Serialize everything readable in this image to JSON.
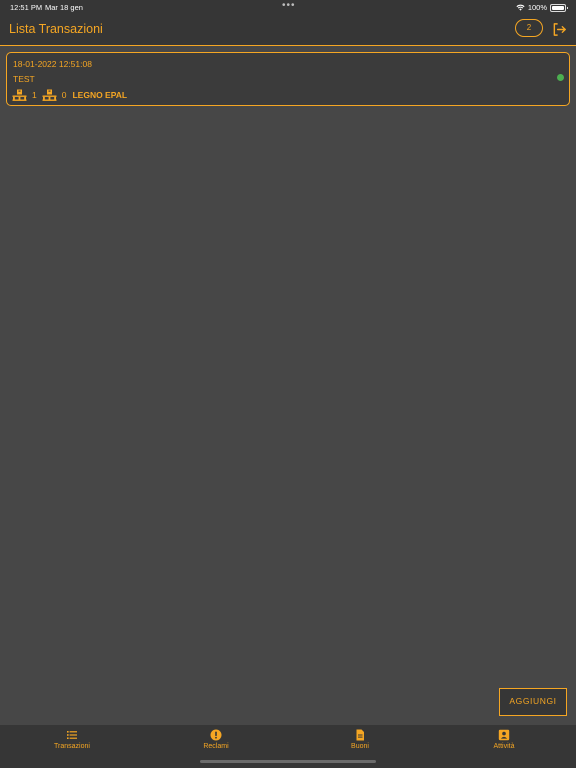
{
  "status_bar": {
    "time": "12:51 PM",
    "date": "Mar 18 gen",
    "dots": "•••",
    "battery": "100%"
  },
  "header": {
    "title": "Lista Transazioni",
    "badge_count": "2"
  },
  "transactions": [
    {
      "datetime": "18-01-2022 12:51:08",
      "name": "TEST",
      "pallet_count_1": "1",
      "pallet_count_2": "0",
      "material": "LEGNO EPAL",
      "status_color": "#4caf50"
    }
  ],
  "actions": {
    "add_label": "AGGIUNGI"
  },
  "tabs": [
    {
      "label": "Transazioni",
      "icon": "list-icon"
    },
    {
      "label": "Reclami",
      "icon": "alert-circle-icon"
    },
    {
      "label": "Buoni",
      "icon": "document-icon"
    },
    {
      "label": "Attività",
      "icon": "person-box-icon"
    }
  ],
  "colors": {
    "accent": "#f5a623",
    "background": "#474747",
    "bar": "#363636",
    "status_ok": "#4caf50"
  }
}
